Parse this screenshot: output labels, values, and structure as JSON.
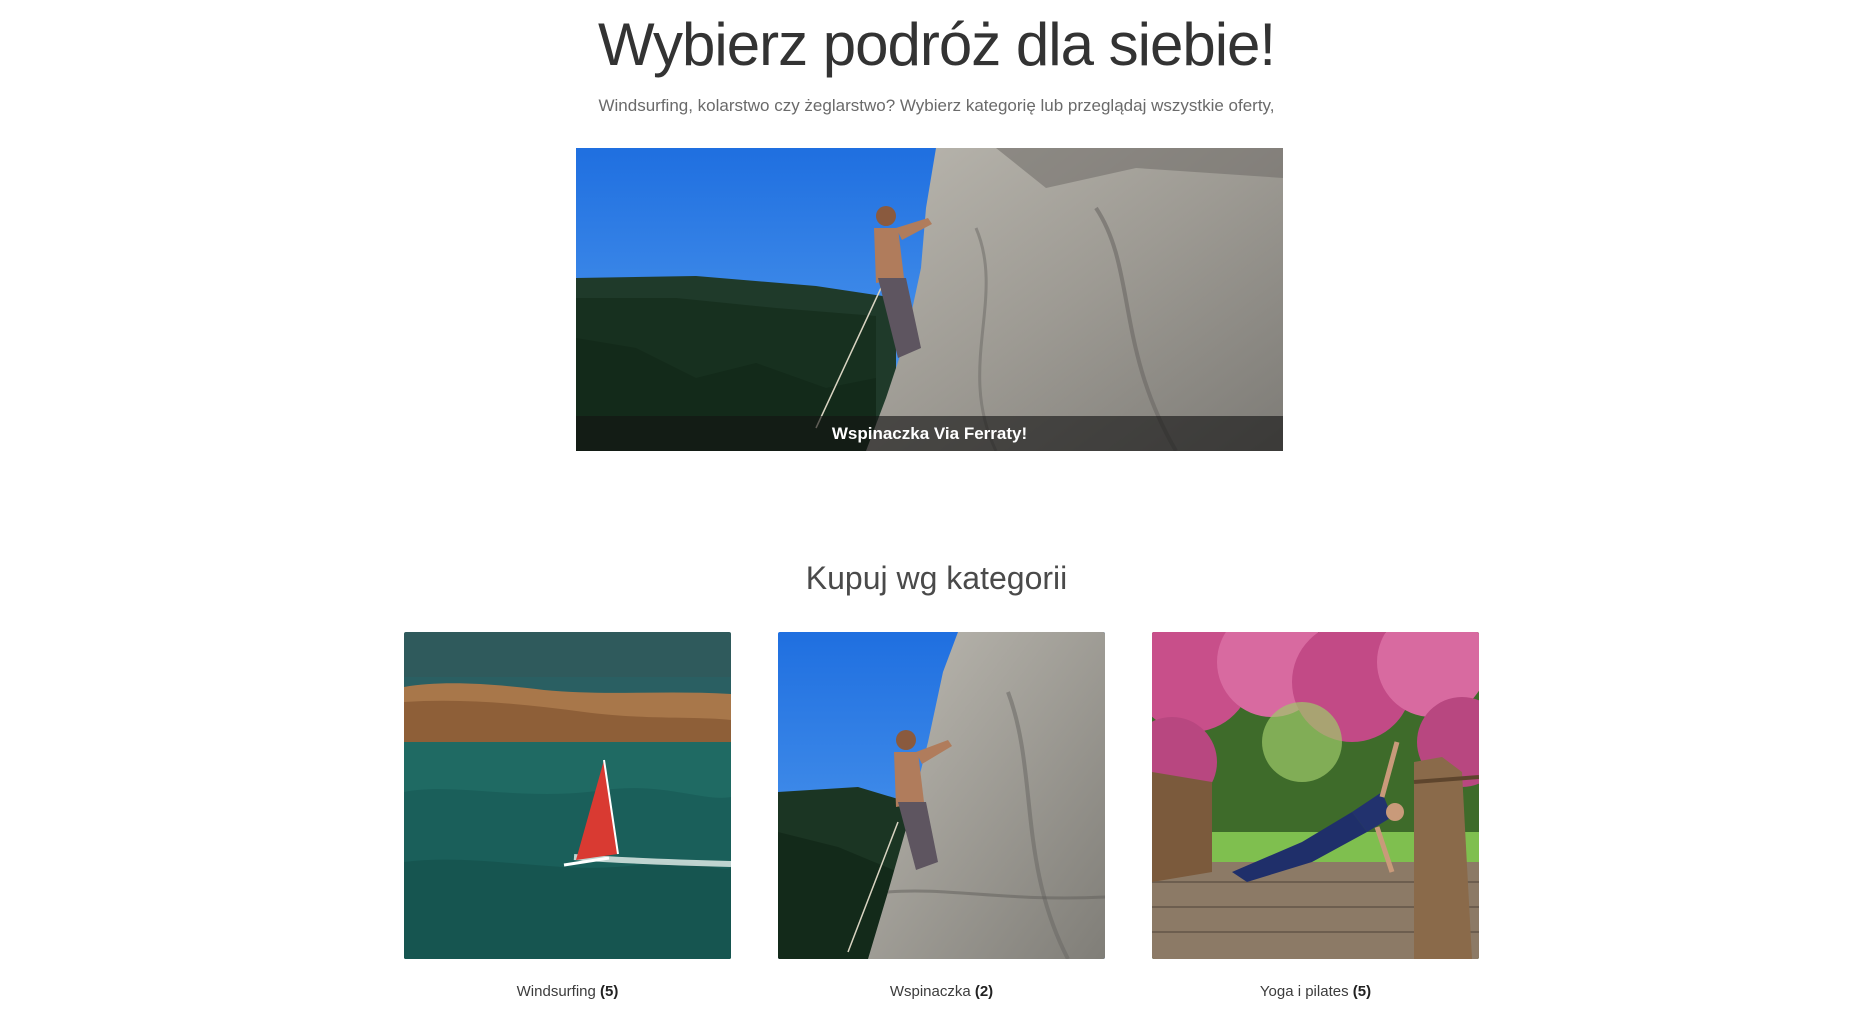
{
  "hero": {
    "title": "Wybierz podróż dla siebie!",
    "subtitle": "Windsurfing, kolarstwo czy żeglarstwo? Wybierz kategorię lub przeglądaj wszystkie oferty,"
  },
  "featured": {
    "caption": "Wspinaczka Via Ferraty!",
    "image": "rock-climbing-photo"
  },
  "categories_section": {
    "title": "Kupuj wg kategorii",
    "items": [
      {
        "name": "Windsurfing",
        "count": "(5)",
        "image": "windsurfing-photo"
      },
      {
        "name": "Wspinaczka",
        "count": "(2)",
        "image": "rock-climbing-photo"
      },
      {
        "name": "Yoga i pilates",
        "count": "(5)",
        "image": "yoga-photo"
      }
    ]
  },
  "colors": {
    "caption_overlay": "#141414",
    "sky": "#2f7ee6",
    "sea": "#1f6a63"
  }
}
